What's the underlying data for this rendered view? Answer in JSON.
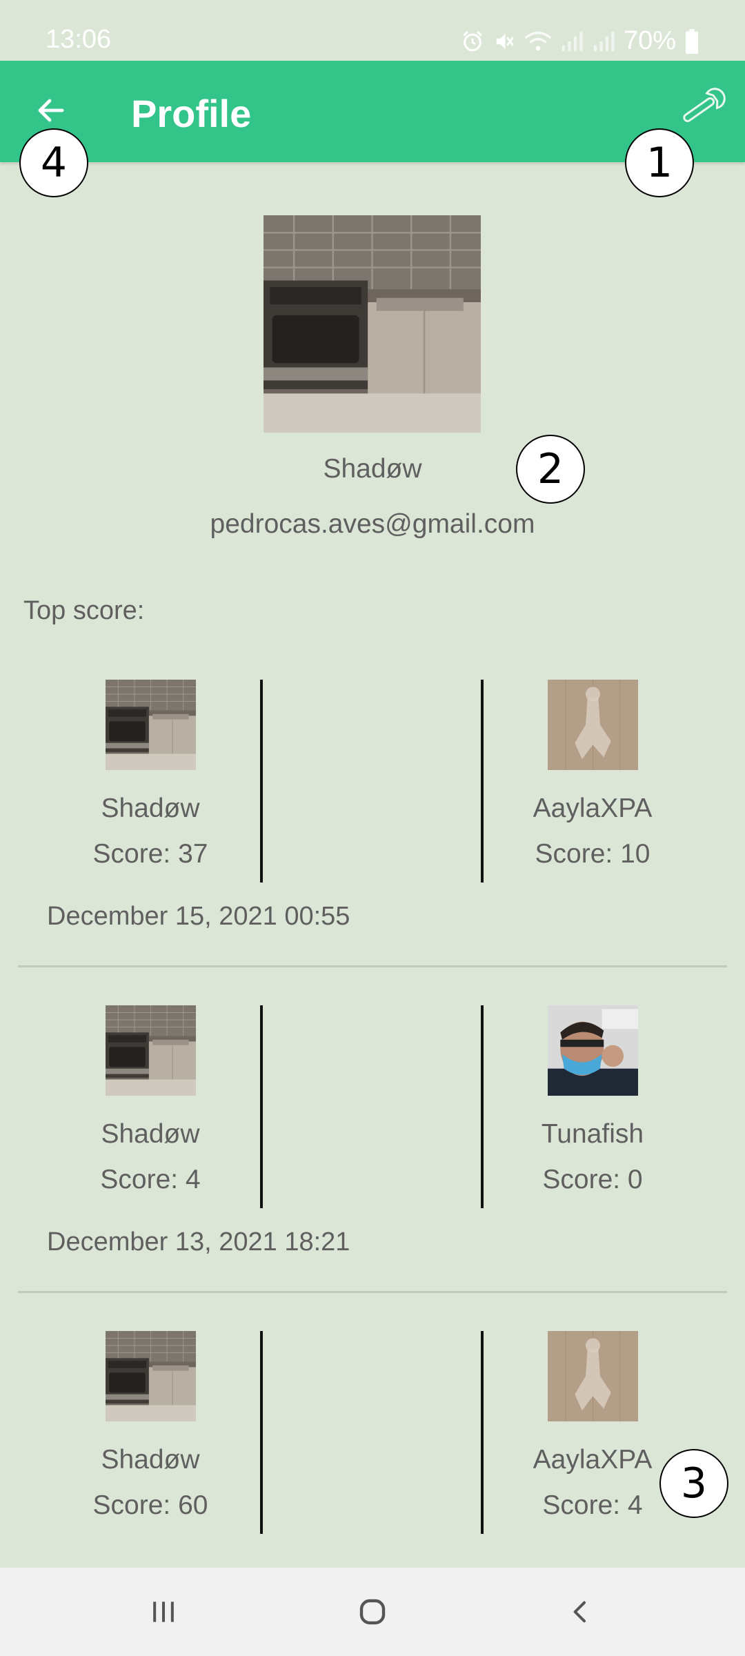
{
  "status_bar": {
    "time": "13:06",
    "battery": "70%"
  },
  "app_bar": {
    "title": "Profile",
    "back_icon": "arrow-left-icon",
    "settings_icon": "wrench-icon",
    "color": "#33c48a"
  },
  "markers": [
    "1",
    "2",
    "3",
    "4"
  ],
  "profile": {
    "name": "Shadøw",
    "email": "pedrocas.aves@gmail.com"
  },
  "top_score_label": "Top score:",
  "matches": [
    {
      "left": {
        "name": "Shadøw",
        "score": "Score: 37",
        "avatar": "kitchen-photo"
      },
      "right": {
        "name": "AaylaXPA",
        "score": "Score: 10",
        "avatar": "wood-figure-photo"
      },
      "date": "December 15, 2021 00:55"
    },
    {
      "left": {
        "name": "Shadøw",
        "score": "Score: 4",
        "avatar": "kitchen-photo"
      },
      "right": {
        "name": "Tunafish",
        "score": "Score: 0",
        "avatar": "person-mask-photo"
      },
      "date": "December 13, 2021 18:21"
    },
    {
      "left": {
        "name": "Shadøw",
        "score": "Score: 60",
        "avatar": "kitchen-photo"
      },
      "right": {
        "name": "AaylaXPA",
        "score": "Score: 4",
        "avatar": "wood-figure-photo"
      }
    }
  ],
  "nav_bar": {
    "recents_icon": "recents-icon",
    "home_icon": "home-icon",
    "back_icon": "nav-back-icon"
  }
}
